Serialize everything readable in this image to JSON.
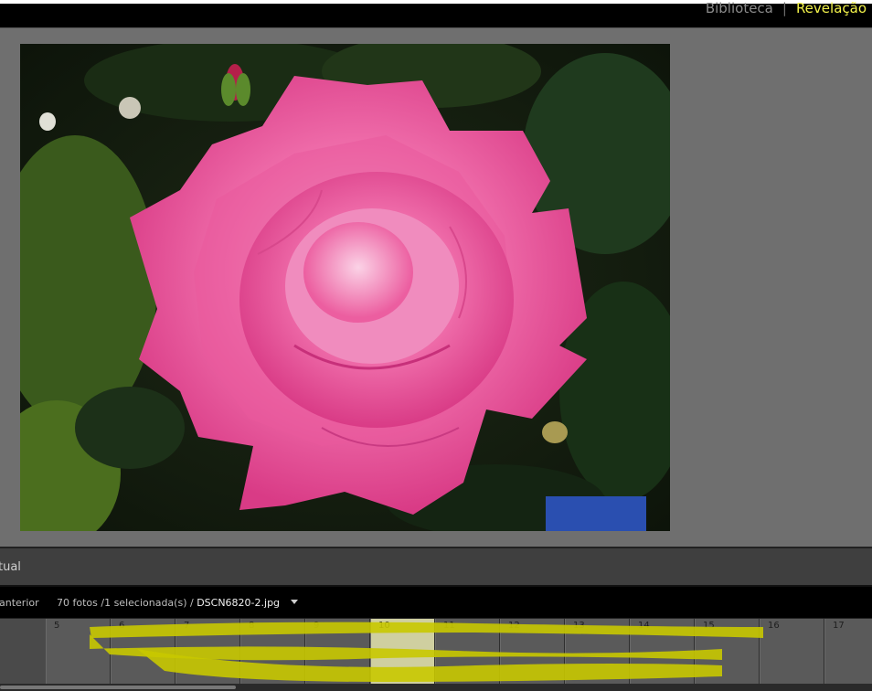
{
  "modules": {
    "library": "Biblioteca",
    "separator": "|",
    "develop": "Revelação"
  },
  "view": {
    "label": "tual"
  },
  "filmstrip_bar": {
    "prev_label": "anterior",
    "count": "70 fotos",
    "selection": "/1 selecionada(s) /",
    "filename": "DSCN6820-2.jpg"
  },
  "filmstrip": {
    "cells": [
      "5",
      "6",
      "7",
      "8",
      "9",
      "10",
      "11",
      "12",
      "13",
      "14",
      "15",
      "16",
      "17"
    ],
    "selected_index": 5
  },
  "colors": {
    "accent": "#f2f24a",
    "annotation": "#c8c800"
  }
}
